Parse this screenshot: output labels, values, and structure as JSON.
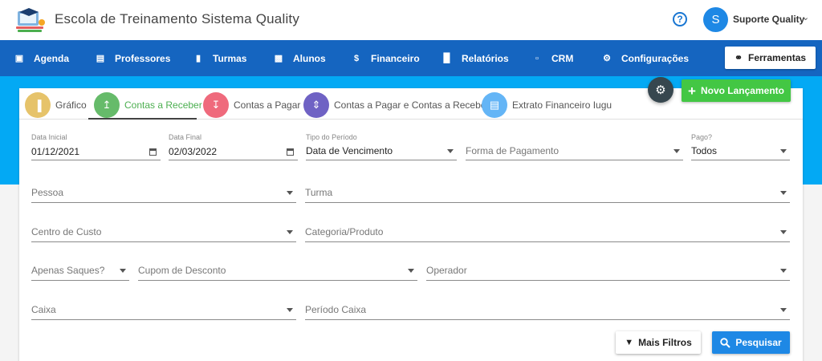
{
  "header": {
    "title": "Escola de Treinamento Sistema Quality",
    "user_initial": "S",
    "user_name": "Suporte Quality"
  },
  "nav": {
    "items": [
      {
        "label": "Agenda",
        "icon": "calendar-icon"
      },
      {
        "label": "Professores",
        "icon": "id-card-icon"
      },
      {
        "label": "Turmas",
        "icon": "book-icon"
      },
      {
        "label": "Alunos",
        "icon": "contact-card-icon"
      },
      {
        "label": "Financeiro",
        "icon": "dollar-icon"
      },
      {
        "label": "Relatórios",
        "icon": "bar-chart-icon"
      },
      {
        "label": "CRM",
        "icon": "chat-icon"
      },
      {
        "label": "Configurações",
        "icon": "gear-icon"
      }
    ],
    "tools_label": "Ferramentas"
  },
  "tabs": [
    {
      "label": "Gráfico",
      "color": "#e6c36a"
    },
    {
      "label": "Contas a Receber",
      "color": "#66bb6a"
    },
    {
      "label": "Contas a Pagar",
      "color": "#ef6a7c"
    },
    {
      "label": "Contas a Pagar e Contas a Receber",
      "color": "#6f62c4"
    },
    {
      "label": "Extrato Financeiro Iugu",
      "color": "#64b5f6"
    }
  ],
  "actions": {
    "novo_label": "Novo Lançamento"
  },
  "filters": {
    "data_inicial": {
      "label": "Data Inicial",
      "value": "01/12/2021"
    },
    "data_final": {
      "label": "Data Final",
      "value": "02/03/2022"
    },
    "tipo_periodo": {
      "label": "Tipo do Período",
      "value": "Data de Vencimento"
    },
    "forma_pagamento": {
      "placeholder": "Forma de Pagamento"
    },
    "pago": {
      "label": "Pago?",
      "value": "Todos"
    },
    "pessoa": {
      "placeholder": "Pessoa"
    },
    "turma": {
      "placeholder": "Turma"
    },
    "centro_custo": {
      "placeholder": "Centro de Custo"
    },
    "categoria": {
      "placeholder": "Categoria/Produto"
    },
    "apenas_saques": {
      "placeholder": "Apenas Saques?"
    },
    "cupom": {
      "placeholder": "Cupom de Desconto"
    },
    "operador": {
      "placeholder": "Operador"
    },
    "caixa": {
      "placeholder": "Caixa"
    },
    "periodo_caixa": {
      "placeholder": "Período Caixa"
    }
  },
  "buttons": {
    "mais_filtros": "Mais Filtros",
    "pesquisar": "Pesquisar"
  },
  "colors": {
    "nav_bg": "#1565c0",
    "band_bg": "#03a9f4",
    "accent_green": "#43c744",
    "primary_blue": "#1e88e5"
  }
}
